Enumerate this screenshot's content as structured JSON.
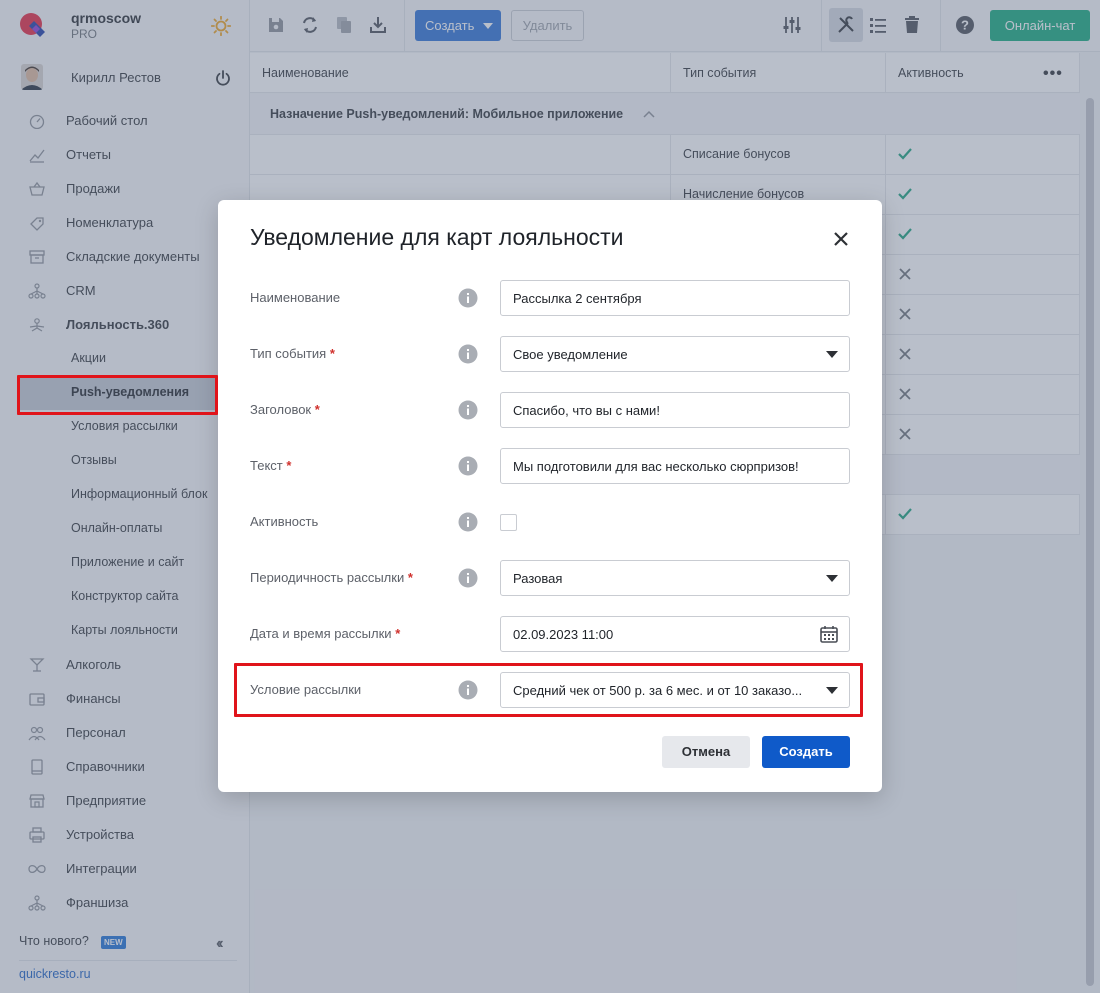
{
  "brand": {
    "name": "qrmoscow",
    "plan": "PRO"
  },
  "user": {
    "name": "Кирилл Рестов"
  },
  "sidebar": {
    "items": [
      {
        "label": "Рабочий стол",
        "icon": "dashboard-icon"
      },
      {
        "label": "Отчеты",
        "icon": "chart-icon"
      },
      {
        "label": "Продажи",
        "icon": "basket-icon"
      },
      {
        "label": "Номенклатура",
        "icon": "tag-icon"
      },
      {
        "label": "Складские документы",
        "icon": "archive-icon"
      },
      {
        "label": "CRM",
        "icon": "network-icon"
      },
      {
        "label": "Лояльность.360",
        "icon": "loyalty-icon"
      }
    ],
    "loyalty_sub": [
      "Акции",
      "Push-уведомления",
      "Условия рассылки",
      "Отзывы",
      "Информационный блок",
      "Онлайн-оплаты",
      "Приложение и сайт",
      "Конструктор сайта",
      "Карты лояльности"
    ],
    "items_after": [
      {
        "label": "Алкоголь",
        "icon": "glass-icon"
      },
      {
        "label": "Финансы",
        "icon": "wallet-icon"
      },
      {
        "label": "Персонал",
        "icon": "people-icon"
      },
      {
        "label": "Справочники",
        "icon": "book-icon"
      },
      {
        "label": "Предприятие",
        "icon": "store-icon"
      },
      {
        "label": "Устройства",
        "icon": "printer-icon"
      },
      {
        "label": "Интеграции",
        "icon": "infinity-icon"
      },
      {
        "label": "Франшиза",
        "icon": "network-icon"
      }
    ],
    "whats_new": "Что нового?",
    "new_badge": "NEW",
    "footer_link": "quickresto.ru"
  },
  "toolbar": {
    "create_label": "Создать",
    "delete_label": "Удалить",
    "chat_label": "Онлайн-чат"
  },
  "table": {
    "headers": [
      "Наименование",
      "Тип события",
      "Активность"
    ],
    "group": "Назначение Push-уведомлений: Мобильное приложение",
    "rows": [
      {
        "type": "Списание бонусов",
        "active": true
      },
      {
        "type": "Начисление бонусов",
        "active": true
      },
      {
        "type": "",
        "active": true
      },
      {
        "type": "",
        "active": false
      },
      {
        "type": "",
        "active": false
      },
      {
        "type": "",
        "active": false
      },
      {
        "type": "",
        "active": false
      },
      {
        "type": "",
        "active": false
      }
    ],
    "row_after_group": {
      "type": "",
      "active": true
    }
  },
  "modal": {
    "title": "Уведомление для карт лояльности",
    "fields": {
      "name": {
        "label": "Наименование",
        "value": "Рассылка 2 сентября"
      },
      "event_type": {
        "label": "Тип события",
        "value": "Свое уведомление"
      },
      "heading": {
        "label": "Заголовок",
        "value": "Спасибо, что вы с нами!"
      },
      "text": {
        "label": "Текст",
        "value": "Мы подготовили для вас несколько сюрпризов!"
      },
      "active": {
        "label": "Активность",
        "checked": false
      },
      "frequency": {
        "label": "Периодичность рассылки",
        "value": "Разовая"
      },
      "datetime": {
        "label": "Дата и время рассылки",
        "value": "02.09.2023 11:00"
      },
      "condition": {
        "label": "Условие рассылки",
        "value": "Средний чек от 500 р. за 6 мес. и от 10 заказо..."
      }
    },
    "cancel_label": "Отмена",
    "submit_label": "Создать"
  },
  "colors": {
    "primary": "#2b6fd6",
    "submit": "#0f5ac9",
    "chat": "#12a97a",
    "highlight": "#e0141a",
    "check": "#16a07a",
    "required": "#d0312d"
  }
}
